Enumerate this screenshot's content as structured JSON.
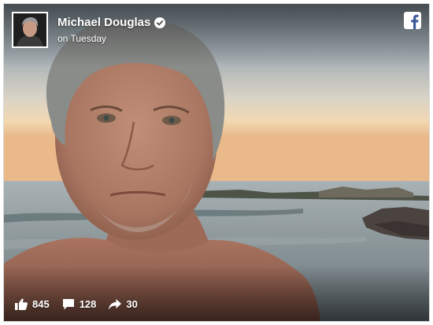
{
  "post": {
    "author_name": "Michael Douglas",
    "timestamp": "on Tuesday",
    "verified_icon": "verified-check-icon",
    "platform_icon": "facebook-icon"
  },
  "stats": {
    "likes": "845",
    "comments": "128",
    "shares": "30",
    "like_icon": "thumbs-up-icon",
    "comment_icon": "comment-bubble-icon",
    "share_icon": "share-arrow-icon"
  },
  "colors": {
    "facebook_blue": "#3b5998",
    "overlay_text": "#ffffff"
  }
}
